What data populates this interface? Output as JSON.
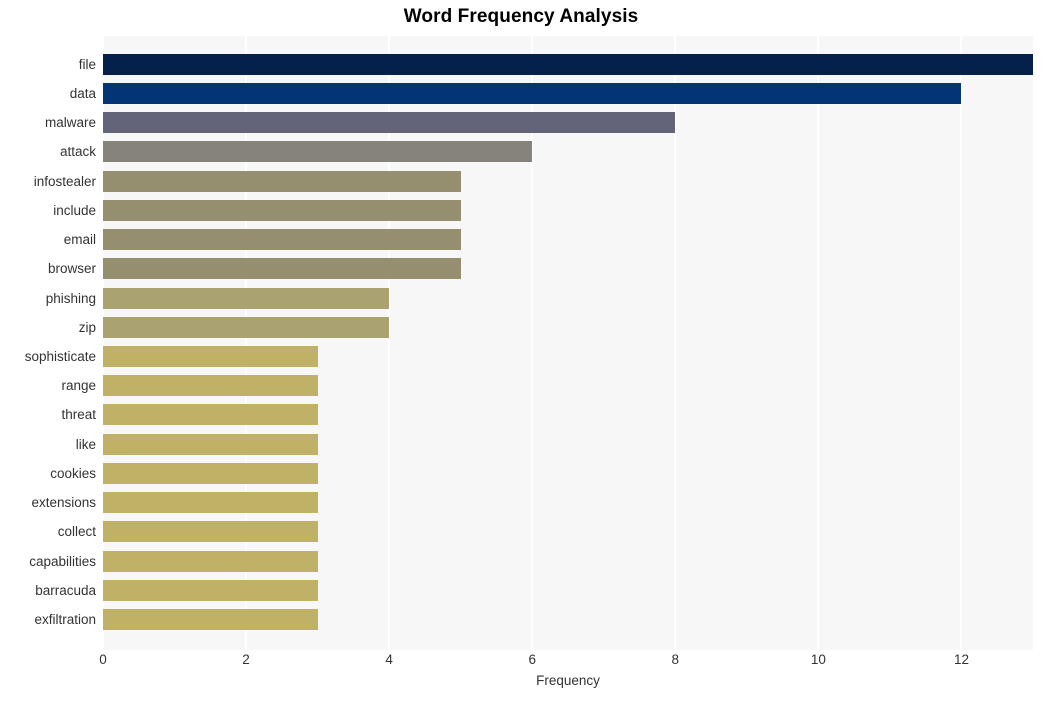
{
  "chart_data": {
    "type": "bar",
    "orientation": "horizontal",
    "title": "Word Frequency Analysis",
    "xlabel": "Frequency",
    "ylabel": "",
    "xlim": [
      0,
      13
    ],
    "ylim": null,
    "grid": true,
    "legend": null,
    "xticks": [
      0,
      2,
      4,
      6,
      8,
      10,
      12
    ],
    "xtick_labels": [
      "0",
      "2",
      "4",
      "6",
      "8",
      "10",
      "12"
    ],
    "categories": [
      "file",
      "data",
      "malware",
      "attack",
      "infostealer",
      "include",
      "email",
      "browser",
      "phishing",
      "zip",
      "sophisticate",
      "range",
      "threat",
      "like",
      "cookies",
      "extensions",
      "collect",
      "capabilities",
      "barracuda",
      "exfiltration"
    ],
    "values": [
      13,
      12,
      8,
      6,
      5,
      5,
      5,
      5,
      4,
      4,
      3,
      3,
      3,
      3,
      3,
      3,
      3,
      3,
      3,
      3
    ],
    "bar_colors": [
      "#05204a",
      "#033475",
      "#63647a",
      "#85837a",
      "#958f70",
      "#958f70",
      "#958f70",
      "#958f70",
      "#aaa270",
      "#aaa270",
      "#bfb266",
      "#bfb266",
      "#bfb266",
      "#bfb266",
      "#bfb266",
      "#bfb266",
      "#bfb266",
      "#bfb266",
      "#bfb266",
      "#bfb266"
    ],
    "plot_background": "#f7f7f7",
    "gridline_color": "#ffffff",
    "text_color": "#333333",
    "title_color": "#000000"
  }
}
